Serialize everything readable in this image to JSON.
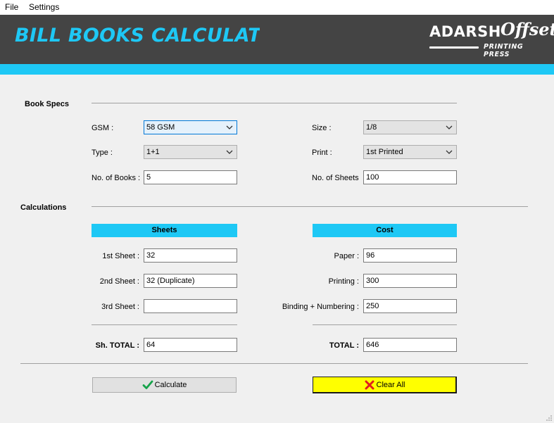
{
  "menu": {
    "file": "File",
    "settings": "Settings"
  },
  "header": {
    "title": "BILL BOOKS CALCULATOR",
    "logo_word": "ADARSH",
    "logo_script": "Offset",
    "logo_sub": "PRINTING PRESS"
  },
  "colors": {
    "accent": "#1ec8f5",
    "header_bg": "#444444",
    "clear_button": "#ffff00",
    "check": "#16a34a",
    "cross": "#e11d1d"
  },
  "specs": {
    "section": "Book Specs",
    "gsm": {
      "label": "GSM :",
      "value": "58 GSM"
    },
    "type": {
      "label": "Type :",
      "value": "1+1"
    },
    "books": {
      "label": "No. of Books :",
      "value": "5"
    },
    "size": {
      "label": "Size :",
      "value": "1/8"
    },
    "print": {
      "label": "Print :",
      "value": "1st Printed"
    },
    "sheets": {
      "label": "No. of Sheets",
      "value": "100"
    }
  },
  "calc": {
    "section": "Calculations",
    "sheets_header": "Sheets",
    "cost_header": "Cost",
    "first": {
      "label": "1st Sheet :",
      "value": "32"
    },
    "second": {
      "label": "2nd Sheet :",
      "value": "32  (Duplicate)"
    },
    "third": {
      "label": "3rd Sheet :",
      "value": ""
    },
    "paper": {
      "label": "Paper :",
      "value": "96"
    },
    "printing": {
      "label": "Printing :",
      "value": "300"
    },
    "binding": {
      "label": "Binding + Numbering :",
      "value": "250"
    },
    "sh_total": {
      "label": "Sh. TOTAL :",
      "value": "64"
    },
    "total": {
      "label": "TOTAL :",
      "value": "646"
    }
  },
  "buttons": {
    "calculate": "Calculate",
    "clear": "Clear All"
  },
  "icons": {
    "check": "check-icon",
    "cross": "cross-icon",
    "dropdown": "chevron-down-icon"
  }
}
